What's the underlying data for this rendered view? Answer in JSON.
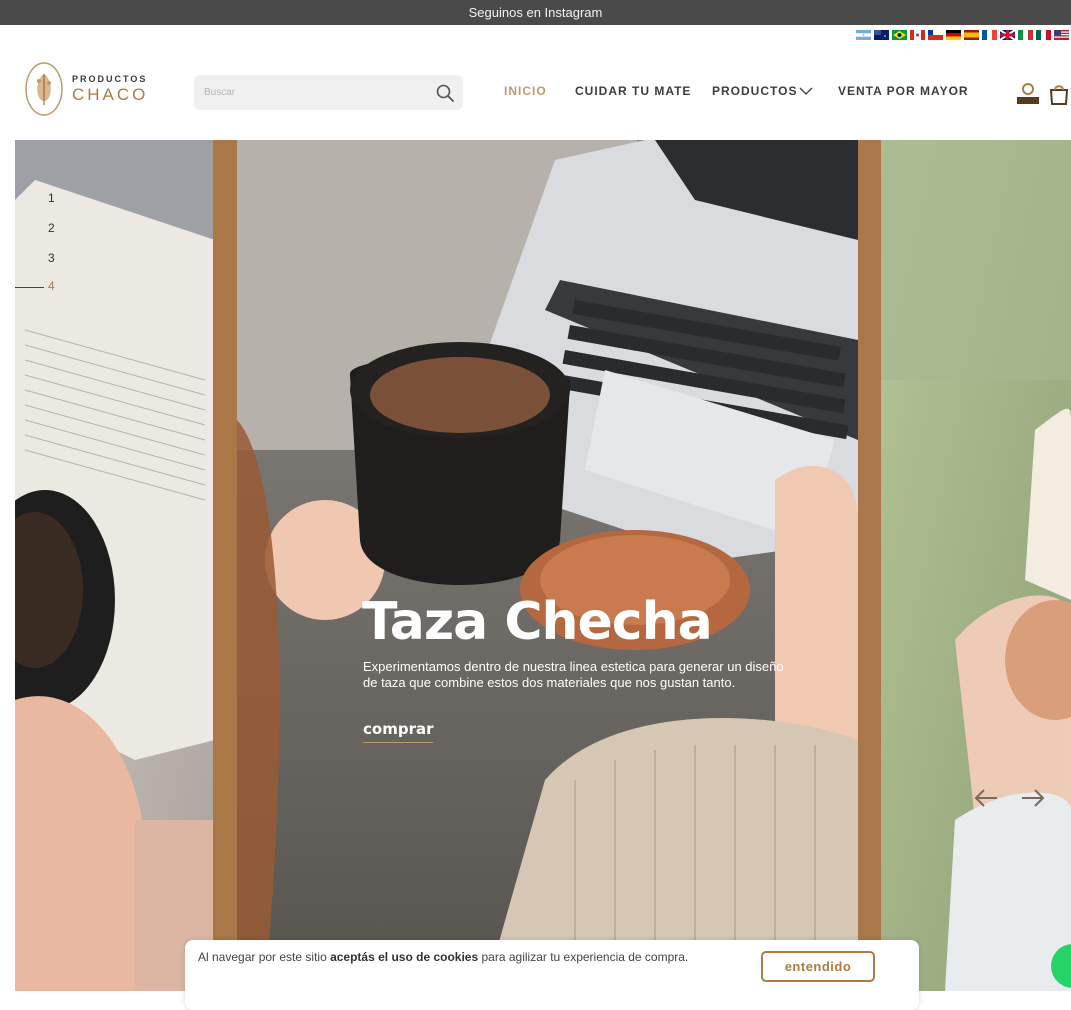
{
  "topbar": {
    "text": "Seguinos en Instagram"
  },
  "flags": [
    "argentina-flag",
    "australia-flag",
    "brazil-flag",
    "canada-flag",
    "chile-flag",
    "germany-flag",
    "spain-flag",
    "france-flag",
    "uk-flag",
    "italy-flag",
    "mexico-flag",
    "usa-flag"
  ],
  "logo": {
    "top": "PRODUCTOS",
    "main": "CHACO"
  },
  "search": {
    "placeholder": "Buscar"
  },
  "nav": {
    "inicio": "INICIO",
    "cuidar": "CUIDAR TU MATE",
    "productos": "PRODUCTOS",
    "mayor": "VENTA POR MAYOR"
  },
  "slider": {
    "pager": [
      "1",
      "2",
      "3",
      "4"
    ],
    "active_page": "4",
    "title": "Taza Checha",
    "description": "Experimentamos dentro de nuestra linea estetica para generar un diseño de taza que combine estos dos materiales que nos gustan tanto.",
    "cta": "comprar"
  },
  "cookie": {
    "text_pre": "Al navegar por este sitio ",
    "text_bold": "aceptás el uso de cookies",
    "text_post": " para agilizar tu experiencia de compra.",
    "button": "entendido"
  },
  "colors": {
    "accent": "#c19a6b",
    "brand": "#b07a45",
    "topbar": "#4a4a4a"
  }
}
